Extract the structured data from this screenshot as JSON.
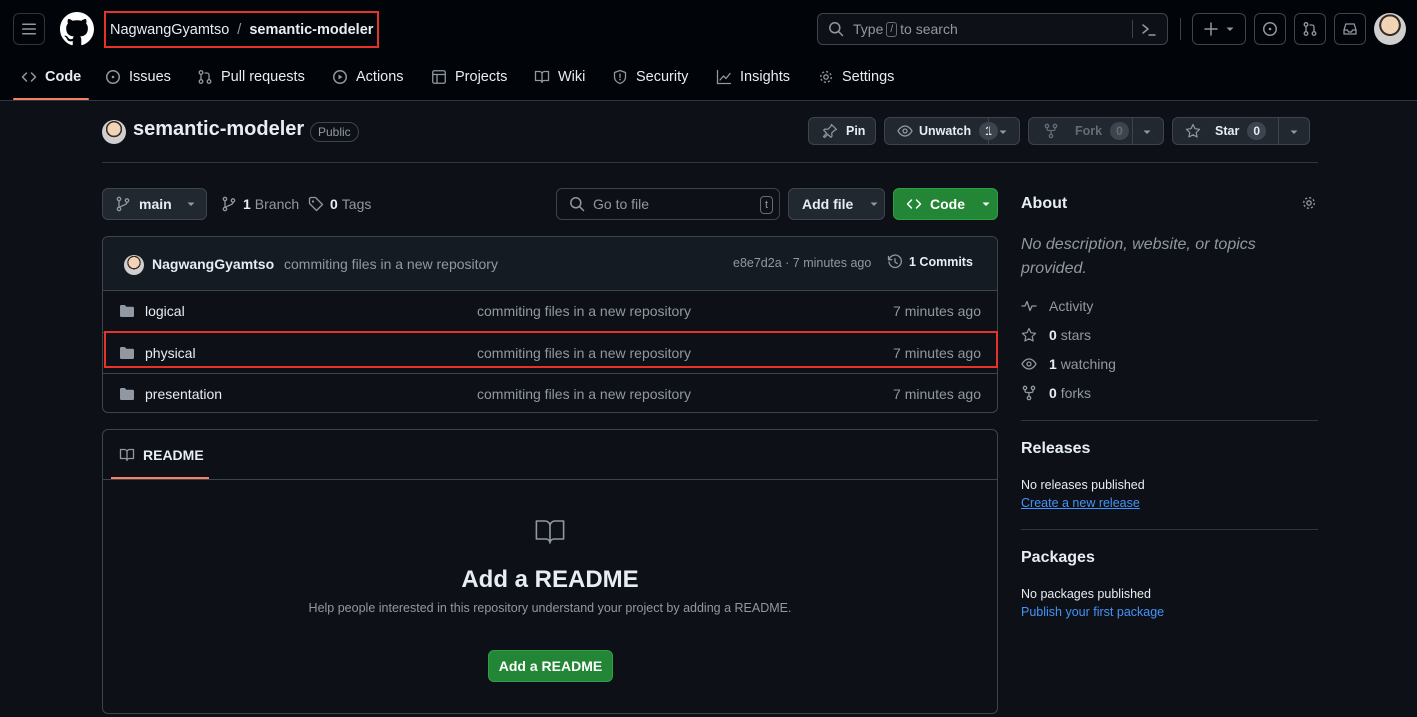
{
  "header": {
    "owner": "NagwangGyamtso",
    "separator": "/",
    "repo": "semantic-modeler",
    "search": {
      "prefix": "Type",
      "key": "/",
      "suffix": "to search"
    }
  },
  "nav": {
    "items": [
      {
        "label": "Code",
        "icon": "code-icon",
        "active": true
      },
      {
        "label": "Issues",
        "icon": "issue-icon"
      },
      {
        "label": "Pull requests",
        "icon": "pull-request-icon"
      },
      {
        "label": "Actions",
        "icon": "play-icon"
      },
      {
        "label": "Projects",
        "icon": "table-icon"
      },
      {
        "label": "Wiki",
        "icon": "book-icon"
      },
      {
        "label": "Security",
        "icon": "shield-icon"
      },
      {
        "label": "Insights",
        "icon": "graph-icon"
      },
      {
        "label": "Settings",
        "icon": "gear-icon"
      }
    ]
  },
  "repo_header": {
    "title": "semantic-modeler",
    "visibility": "Public",
    "pin_label": "Pin",
    "unwatch_label": "Unwatch",
    "watch_count": "1",
    "fork_label": "Fork",
    "fork_count": "0",
    "star_label": "Star",
    "star_count": "0"
  },
  "toolbar": {
    "branch": "main",
    "branch_count": "1",
    "branch_label": "Branch",
    "tag_count": "0",
    "tag_label": "Tags",
    "goto_placeholder": "Go to file",
    "goto_key": "t",
    "add_file": "Add file",
    "code": "Code"
  },
  "commit": {
    "author": "NagwangGyamtso",
    "message": "commiting files in a new repository",
    "hash_time": "e8e7d2a · 7 minutes ago",
    "count_label": "1 Commits"
  },
  "files": [
    {
      "name": "logical",
      "message": "commiting files in a new repository",
      "time": "7 minutes ago"
    },
    {
      "name": "physical",
      "message": "commiting files in a new repository",
      "time": "7 minutes ago"
    },
    {
      "name": "presentation",
      "message": "commiting files in a new repository",
      "time": "7 minutes ago"
    }
  ],
  "readme": {
    "tab": "README",
    "title": "Add a README",
    "subtitle": "Help people interested in this repository understand your project by adding a README.",
    "button": "Add a README"
  },
  "sidebar": {
    "about_title": "About",
    "about_desc": "No description, website, or topics provided.",
    "activity": "Activity",
    "stars_count": "0",
    "stars_label": "stars",
    "watching_count": "1",
    "watching_label": "watching",
    "forks_count": "0",
    "forks_label": "forks",
    "releases_title": "Releases",
    "releases_text": "No releases published",
    "releases_link": "Create a new release",
    "packages_title": "Packages",
    "packages_text": "No packages published",
    "packages_link": "Publish your first package"
  },
  "colors": {
    "accent_green": "#238636",
    "link_blue": "#4493f8",
    "highlight_red": "#e5332a",
    "tab_underline": "#f78166"
  }
}
